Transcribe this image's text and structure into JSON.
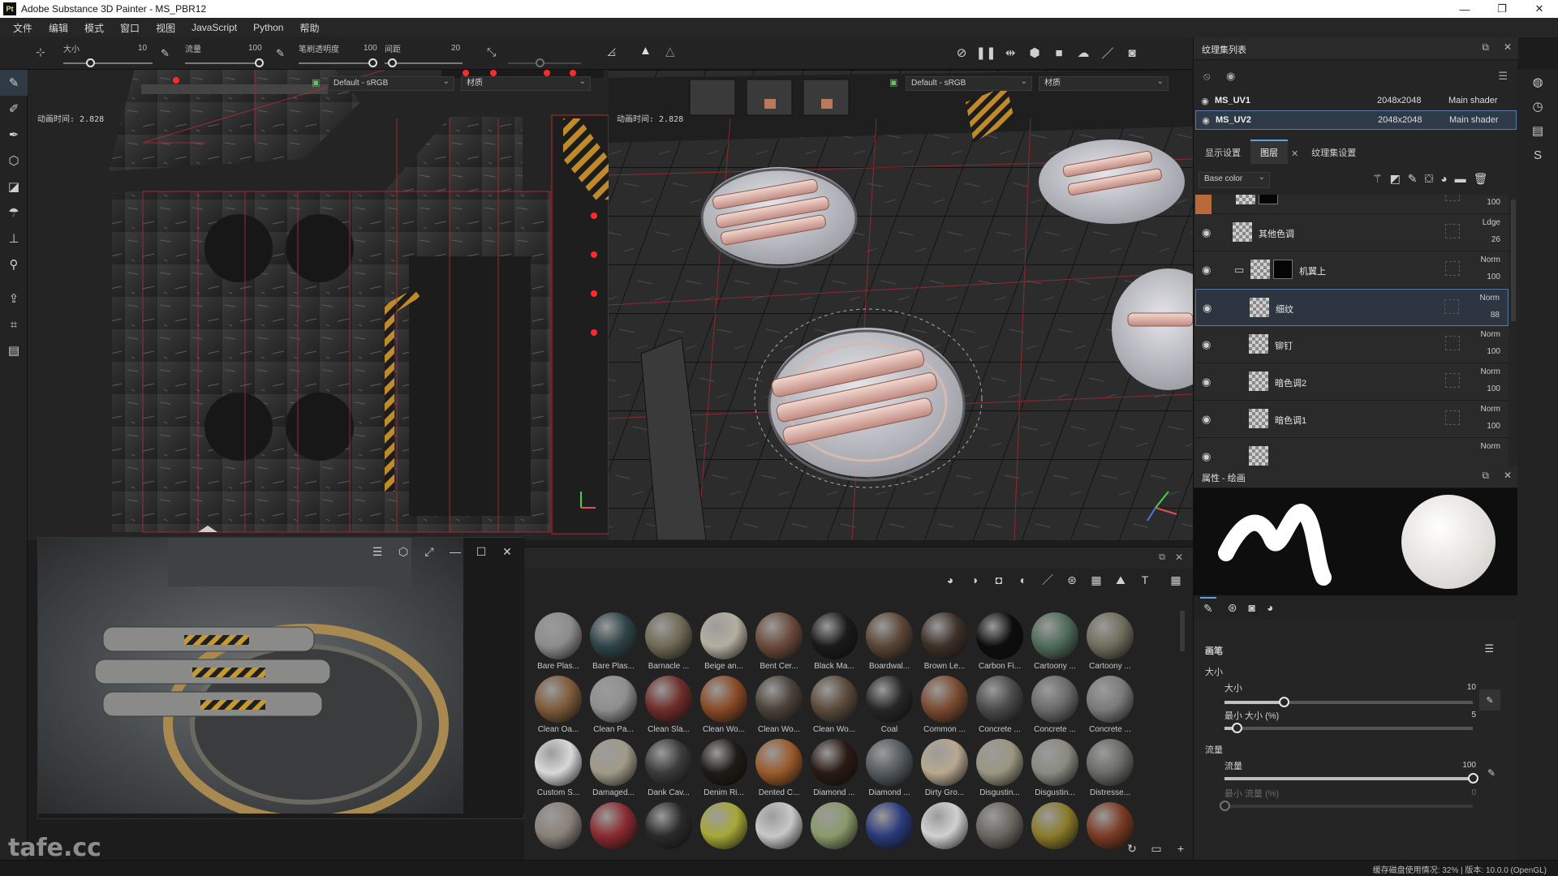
{
  "app": {
    "title": "Adobe Substance 3D Painter - MS_PBR12",
    "icon_label": "Pt"
  },
  "window_controls": [
    "minimize-icon",
    "restore-icon",
    "close-icon"
  ],
  "menu": [
    "文件",
    "编辑",
    "模式",
    "窗口",
    "视图",
    "JavaScript",
    "Python",
    "帮助"
  ],
  "toolbar": {
    "size": {
      "label": "大小",
      "value": "10"
    },
    "flow": {
      "label": "流量",
      "value": "100"
    },
    "stroke_opacity": {
      "label": "笔刷透明度",
      "value": "100"
    },
    "spacing": {
      "label": "间距",
      "value": "20"
    }
  },
  "uv_view": {
    "time_label": "动画时间: 2.828",
    "colorspace": "Default - sRGB",
    "channel": "材质"
  },
  "view_3d": {
    "time_label": "动画时间: 2.828",
    "colorspace": "Default - sRGB",
    "channel": "材质"
  },
  "texture_sets": {
    "title": "纹理集列表",
    "items": [
      {
        "name": "MS_UV1",
        "resolution": "2048x2048",
        "shader": "Main shader",
        "selected": false
      },
      {
        "name": "MS_UV2",
        "resolution": "2048x2048",
        "shader": "Main shader",
        "selected": true
      }
    ]
  },
  "layers_panel": {
    "tabs": [
      "显示设置",
      "图层",
      "纹理集设置"
    ],
    "active_tab": "图层",
    "channel": "Base color",
    "layers": [
      {
        "name": "",
        "blend": "",
        "opacity": "100"
      },
      {
        "name": "其他色调",
        "blend": "Ldge",
        "opacity": "26"
      },
      {
        "name": "机翼上",
        "blend": "Norm",
        "opacity": "100",
        "folder": true
      },
      {
        "name": "细纹",
        "blend": "Norm",
        "opacity": "88",
        "selected": true
      },
      {
        "name": "铆钉",
        "blend": "Norm",
        "opacity": "100"
      },
      {
        "name": "暗色调2",
        "blend": "Norm",
        "opacity": "100"
      },
      {
        "name": "暗色调1",
        "blend": "Norm",
        "opacity": "100"
      },
      {
        "name": "",
        "blend": "Norm",
        "opacity": ""
      }
    ]
  },
  "properties": {
    "title": "属性 - 绘画",
    "section": "画笔",
    "size_group": "大小",
    "size_label": "大小",
    "size_value": "10",
    "size_level": 0.24,
    "min_size_label": "最小 大小 (%)",
    "min_size_value": "5",
    "min_size_level": 0.05,
    "flow_group": "流量",
    "flow_label": "流量",
    "flow_value": "100",
    "flow_level": 1.0,
    "min_flow_label": "最小 流量 (%)",
    "min_flow_value": "0",
    "min_flow_level": 0.0
  },
  "shelf": {
    "materials": [
      {
        "name": "Bare Plas...",
        "color": "#8c8c8c"
      },
      {
        "name": "Bare Plas...",
        "color": "#2f4448"
      },
      {
        "name": "Barnacle ...",
        "color": "#6f6a55"
      },
      {
        "name": "Beige an...",
        "color": "#b5aea0"
      },
      {
        "name": "Bent Cer...",
        "color": "#6a4a3a"
      },
      {
        "name": "Black Ma...",
        "color": "#1a1a1a"
      },
      {
        "name": "Boardwal...",
        "color": "#5a4535"
      },
      {
        "name": "Brown Le...",
        "color": "#3d3028"
      },
      {
        "name": "Carbon Fi...",
        "color": "#0d0d0d"
      },
      {
        "name": "Cartoony ...",
        "color": "#4f6a58"
      },
      {
        "name": "Cartoony ...",
        "color": "#6f6d5b"
      },
      {
        "name": "Clean Oa...",
        "color": "#7d5a38"
      },
      {
        "name": "Clean Pa...",
        "color": "#8f8f8f"
      },
      {
        "name": "Clean Sla...",
        "color": "#6e2d2a"
      },
      {
        "name": "Clean Wo...",
        "color": "#8a4a25"
      },
      {
        "name": "Clean Wo...",
        "color": "#4a4238"
      },
      {
        "name": "Clean Wo...",
        "color": "#5a4a3a"
      },
      {
        "name": "Coal",
        "color": "#262626"
      },
      {
        "name": "Common ...",
        "color": "#7a4a30"
      },
      {
        "name": "Concrete ...",
        "color": "#4a4a4a"
      },
      {
        "name": "Concrete ...",
        "color": "#6a6a6a"
      },
      {
        "name": "Concrete ...",
        "color": "#7a7a7a"
      },
      {
        "name": "Custom S...",
        "color": "#d8d8d8"
      },
      {
        "name": "Damaged...",
        "color": "#a09a88"
      },
      {
        "name": "Dank Cav...",
        "color": "#3a3a3a"
      },
      {
        "name": "Denim Ri...",
        "color": "#1e1a16"
      },
      {
        "name": "Dented C...",
        "color": "#9a5a2a"
      },
      {
        "name": "Diamond ...",
        "color": "#2a1a14"
      },
      {
        "name": "Diamond ...",
        "color": "#555a5e"
      },
      {
        "name": "Dirty Gro...",
        "color": "#b8a890"
      },
      {
        "name": "Disgustin...",
        "color": "#9a9680"
      },
      {
        "name": "Disgustin...",
        "color": "#8a8a80"
      },
      {
        "name": "Distresse...",
        "color": "#6a6a66"
      },
      {
        "name": "",
        "color": "#8a8078"
      },
      {
        "name": "",
        "color": "#8a2a30"
      },
      {
        "name": "",
        "color": "#2a2a2a"
      },
      {
        "name": "",
        "color": "#a6a836"
      },
      {
        "name": "",
        "color": "#c8c8c8"
      },
      {
        "name": "",
        "color": "#8a9a6a"
      },
      {
        "name": "",
        "color": "#2a3a7a"
      },
      {
        "name": "",
        "color": "#d0d0d0"
      },
      {
        "name": "",
        "color": "#6a6660"
      },
      {
        "name": "",
        "color": "#8a7a2a"
      },
      {
        "name": "",
        "color": "#7a3a22"
      }
    ]
  },
  "status": {
    "text": "缓存磁盘使用情况:  32%  |  版本: 10.0.0  (OpenGL)"
  },
  "watermark": "tafe.cc",
  "colors": {
    "accent": "#5ea0e8",
    "selection_border": "#5b7aa8",
    "uv_lines": "#c0303a"
  }
}
